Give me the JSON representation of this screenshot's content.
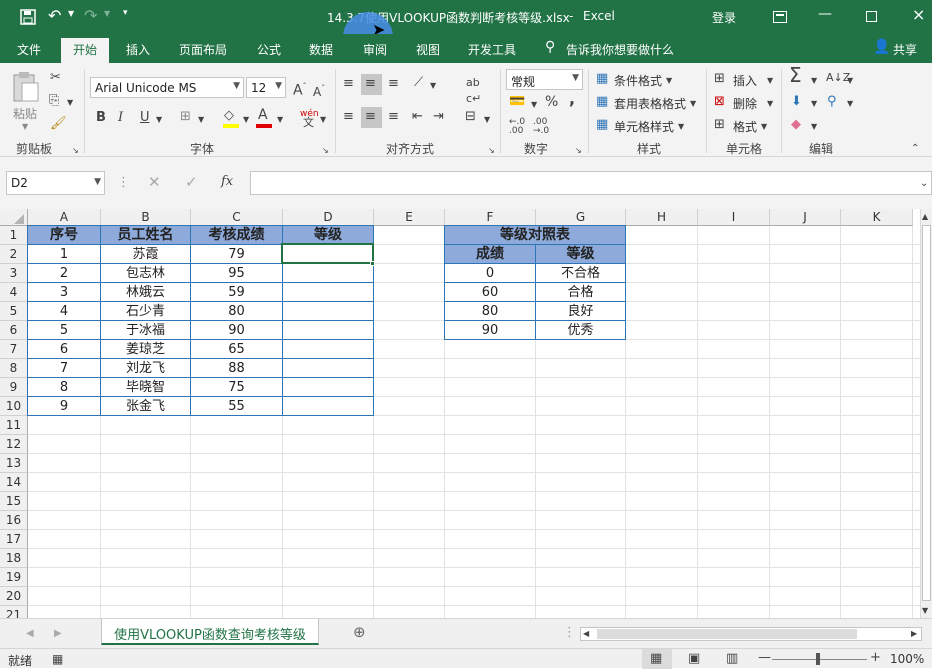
{
  "title_bar": {
    "file_title": "14.3.7使用VLOOKUP函数判断考核等级.xlsx",
    "separator": "-",
    "app_name": "Excel",
    "login_label": "登录"
  },
  "ribbon_tabs": [
    "文件",
    "开始",
    "插入",
    "页面布局",
    "公式",
    "数据",
    "审阅",
    "视图",
    "开发工具"
  ],
  "active_tab": "开始",
  "tell_me": "告诉我你想要做什么",
  "share_label": "共享",
  "ribbon": {
    "clipboard": {
      "paste_label": "粘贴",
      "group_label": "剪贴板"
    },
    "font": {
      "font_name": "Arial Unicode MS",
      "font_size": "12",
      "group_label": "字体",
      "bold": "B",
      "italic": "I",
      "underline": "U",
      "phonetic": "wén"
    },
    "alignment": {
      "group_label": "对齐方式"
    },
    "number": {
      "format": "常规",
      "percent": "%",
      "comma": ",",
      "group_label": "数字"
    },
    "styles": {
      "conditional": "条件格式",
      "table_format": "套用表格格式",
      "cell_styles": "单元格样式",
      "group_label": "样式"
    },
    "cells": {
      "insert": "插入",
      "delete": "删除",
      "format": "格式",
      "group_label": "单元格"
    },
    "editing": {
      "group_label": "编辑"
    }
  },
  "formula_bar": {
    "name_box": "D2",
    "fx": "fx",
    "formula": ""
  },
  "columns": [
    "A",
    "B",
    "C",
    "D",
    "E",
    "F",
    "G",
    "H",
    "I",
    "J",
    "K"
  ],
  "rows": [
    "1",
    "2",
    "3",
    "4",
    "5",
    "6",
    "7",
    "8",
    "9",
    "10",
    "11",
    "12",
    "13",
    "14",
    "15",
    "16",
    "17",
    "18",
    "19",
    "20",
    "21"
  ],
  "main_table": {
    "headers": [
      "序号",
      "员工姓名",
      "考核成绩",
      "等级"
    ],
    "rows": [
      [
        "1",
        "苏霞",
        "79",
        ""
      ],
      [
        "2",
        "包志林",
        "95",
        ""
      ],
      [
        "3",
        "林娥云",
        "59",
        ""
      ],
      [
        "4",
        "石少青",
        "80",
        ""
      ],
      [
        "5",
        "于冰福",
        "90",
        ""
      ],
      [
        "6",
        "姜琼芝",
        "65",
        ""
      ],
      [
        "7",
        "刘龙飞",
        "88",
        ""
      ],
      [
        "8",
        "毕晓智",
        "75",
        ""
      ],
      [
        "9",
        "张金飞",
        "55",
        ""
      ]
    ]
  },
  "lookup_table": {
    "title": "等级对照表",
    "headers": [
      "成绩",
      "等级"
    ],
    "rows": [
      [
        "0",
        "不合格"
      ],
      [
        "60",
        "合格"
      ],
      [
        "80",
        "良好"
      ],
      [
        "90",
        "优秀"
      ]
    ]
  },
  "sheet_tab": "使用VLOOKUP函数查询考核等级",
  "status": {
    "ready": "就绪",
    "zoom": "100%"
  },
  "colors": {
    "excel_green": "#217346",
    "header_fill": "#8eaadb",
    "border_blue": "#2e75b6"
  }
}
